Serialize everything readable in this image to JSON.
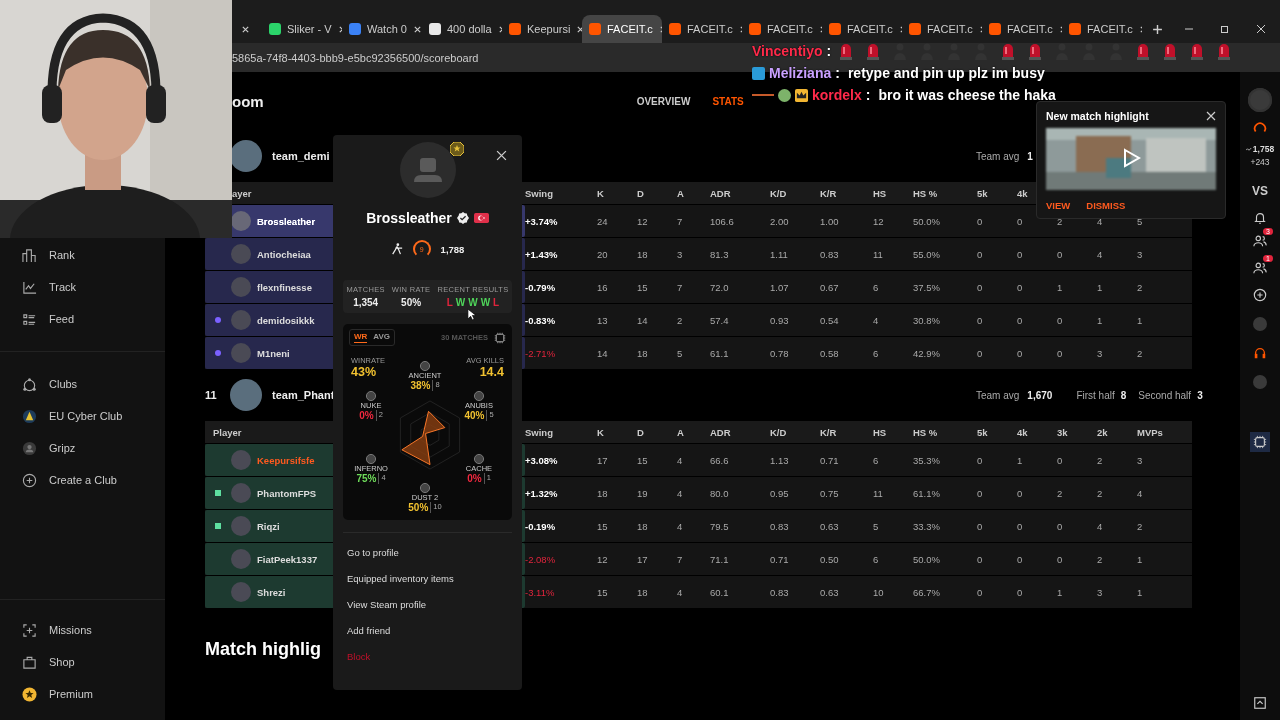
{
  "browser": {
    "tabs": [
      {
        "selected": false
      },
      {
        "title": "Sliker - V",
        "color": "#2bd46a",
        "selected": false
      },
      {
        "title": "Watch 0",
        "color": "#3b82f6",
        "selected": false
      },
      {
        "title": "400 dolla",
        "color": "#e8e8e8",
        "selected": false
      },
      {
        "title": "Keepursi",
        "color": "#ff5500",
        "selected": false
      },
      {
        "title": "FACEIT.c",
        "color": "#ff5500",
        "selected": true
      },
      {
        "title": "FACEIT.c",
        "color": "#ff5500",
        "selected": false
      },
      {
        "title": "FACEIT.c",
        "color": "#ff5500",
        "selected": false
      },
      {
        "title": "FACEIT.c",
        "color": "#ff5500",
        "selected": false
      },
      {
        "title": "FACEIT.c",
        "color": "#ff5500",
        "selected": false
      },
      {
        "title": "FACEIT.c",
        "color": "#ff5500",
        "selected": false
      },
      {
        "title": "FACEIT.c",
        "color": "#ff5500",
        "selected": false
      }
    ],
    "url": "5865a-74f8-4403-bbb9-e5bc92356500/scoreboard"
  },
  "chat": [
    {
      "user": "Vincentiyo",
      "color": "#ff2a4a",
      "sep": ":",
      "emotes": [
        {
          "kind": "siren"
        },
        {
          "kind": "siren"
        },
        {
          "kind": "figure"
        },
        {
          "kind": "figure"
        },
        {
          "kind": "figure"
        },
        {
          "kind": "figure"
        },
        {
          "kind": "siren"
        },
        {
          "kind": "siren"
        },
        {
          "kind": "figure"
        },
        {
          "kind": "figure"
        },
        {
          "kind": "figure"
        },
        {
          "kind": "siren"
        },
        {
          "kind": "siren"
        },
        {
          "kind": "siren"
        },
        {
          "kind": "siren"
        }
      ]
    },
    {
      "user": "Meliziana",
      "color": "#c9a0ff",
      "sep": ":",
      "text": "retype and pin up plz im busy"
    },
    {
      "user": "kordelx",
      "color": "#ff2a4a",
      "sep": ":",
      "text": "bro it was cheese the haka"
    }
  ],
  "sidebar": {
    "groups": [
      [
        {
          "label": "Rank",
          "kind": "rank"
        },
        {
          "label": "Track",
          "kind": "track"
        },
        {
          "label": "Feed",
          "kind": "feed"
        }
      ],
      [
        {
          "label": "Clubs",
          "kind": "clubs"
        },
        {
          "label": "EU Cyber Club",
          "kind": "club"
        },
        {
          "label": "Gripz",
          "kind": "avatar"
        },
        {
          "label": "Create a Club",
          "kind": "add"
        }
      ],
      [
        {
          "label": "Missions",
          "kind": "missions"
        },
        {
          "label": "Shop",
          "kind": "shop"
        },
        {
          "label": "Premium",
          "kind": "premium"
        }
      ]
    ]
  },
  "page": {
    "title": "oom",
    "tabs": [
      {
        "label": "OVERVIEW",
        "selected": false
      },
      {
        "label": "STATS",
        "selected": true
      }
    ],
    "teams": [
      {
        "name": "team_demi",
        "color": "#27284d",
        "avg_label": "Team avg",
        "avg_value": "1",
        "columns": [
          "ayer",
          "Swing",
          "K",
          "D",
          "A",
          "ADR",
          "K/D",
          "K/R",
          "HS",
          "HS %",
          "5k",
          "4k"
        ],
        "players": [
          {
            "name": "Brossleather",
            "selected": true,
            "highlighted": false,
            "swing_bad": false,
            "stats": [
              "+3.74%",
              "24",
              "12",
              "7",
              "106.6",
              "2.00",
              "1.00",
              "12",
              "50.0%",
              "0",
              "0",
              "2",
              "4",
              "5"
            ]
          },
          {
            "name": "Antiocheiaa",
            "selected": false,
            "highlighted": false,
            "swing_bad": false,
            "stats": [
              "+1.43%",
              "20",
              "18",
              "3",
              "81.3",
              "1.11",
              "0.83",
              "11",
              "55.0%",
              "0",
              "0",
              "0",
              "4",
              "3"
            ]
          },
          {
            "name": "flexnfinesse",
            "selected": false,
            "highlighted": false,
            "swing_bad": false,
            "stats": [
              "-0.79%",
              "16",
              "15",
              "7",
              "72.0",
              "1.07",
              "0.67",
              "6",
              "37.5%",
              "0",
              "0",
              "1",
              "1",
              "2"
            ]
          },
          {
            "name": "demidosikkk",
            "selected": false,
            "highlighted": false,
            "swing_bad": false,
            "marker": {
              "kind": "dot",
              "color": "#7b61ff"
            },
            "stats": [
              "-0.83%",
              "13",
              "14",
              "2",
              "57.4",
              "0.93",
              "0.54",
              "4",
              "30.8%",
              "0",
              "0",
              "0",
              "1",
              "1"
            ]
          },
          {
            "name": "M1neni",
            "selected": false,
            "highlighted": false,
            "swing_bad": true,
            "marker": {
              "kind": "dot",
              "color": "#7b61ff"
            },
            "stats": [
              "-2.71%",
              "14",
              "18",
              "5",
              "61.1",
              "0.78",
              "0.58",
              "6",
              "42.9%",
              "0",
              "0",
              "0",
              "3",
              "2"
            ]
          }
        ]
      },
      {
        "rank": "11",
        "name": "team_Phant",
        "color": "#1d3a30",
        "avg_label": "Team avg",
        "avg_value": "1,670",
        "halves": [
          {
            "label": "First half",
            "value": "8"
          },
          {
            "label": "Second half",
            "value": "3"
          }
        ],
        "columns": [
          "Player",
          "Swing",
          "K",
          "D",
          "A",
          "ADR",
          "K/D",
          "K/R",
          "HS",
          "HS %",
          "5k",
          "4k",
          "3k",
          "2k",
          "MVPs"
        ],
        "players": [
          {
            "name": "Keepursifsfe",
            "selected": false,
            "highlighted": true,
            "swing_bad": false,
            "stats": [
              "+3.08%",
              "17",
              "15",
              "4",
              "66.6",
              "1.13",
              "0.71",
              "6",
              "35.3%",
              "0",
              "1",
              "0",
              "2",
              "3"
            ]
          },
          {
            "name": "PhantomFPS",
            "selected": false,
            "highlighted": false,
            "swing_bad": false,
            "marker": {
              "kind": "square",
              "color": "#5ee0a0"
            },
            "stats": [
              "+1.32%",
              "18",
              "19",
              "4",
              "80.0",
              "0.95",
              "0.75",
              "11",
              "61.1%",
              "0",
              "0",
              "2",
              "2",
              "4"
            ]
          },
          {
            "name": "Riqzi",
            "selected": false,
            "highlighted": false,
            "swing_bad": false,
            "marker": {
              "kind": "square",
              "color": "#5ee0a0"
            },
            "stats": [
              "-0.19%",
              "15",
              "18",
              "4",
              "79.5",
              "0.83",
              "0.63",
              "5",
              "33.3%",
              "0",
              "0",
              "0",
              "4",
              "2"
            ]
          },
          {
            "name": "FiatPeek1337",
            "selected": false,
            "highlighted": false,
            "swing_bad": true,
            "stats": [
              "-2.08%",
              "12",
              "17",
              "7",
              "71.1",
              "0.71",
              "0.50",
              "6",
              "50.0%",
              "0",
              "0",
              "0",
              "2",
              "1"
            ]
          },
          {
            "name": "Shrezi",
            "selected": false,
            "highlighted": false,
            "swing_bad": true,
            "stats": [
              "-3.11%",
              "15",
              "18",
              "4",
              "60.1",
              "0.83",
              "0.63",
              "10",
              "66.7%",
              "0",
              "0",
              "1",
              "3",
              "1"
            ]
          }
        ]
      }
    ],
    "section_heading": "Match highlig"
  },
  "player_card": {
    "name": "Brossleather",
    "verified": true,
    "level": "9",
    "elo": "1,788",
    "stats": [
      {
        "label": "MATCHES",
        "value": "1,354"
      },
      {
        "label": "WIN RATE",
        "value": "50%"
      }
    ],
    "recent_label": "RECENT RESULTS",
    "recent": [
      {
        "result": "L",
        "win": false
      },
      {
        "result": "W",
        "win": true
      },
      {
        "result": "W",
        "win": true
      },
      {
        "result": "W",
        "win": true
      },
      {
        "result": "L",
        "win": false
      }
    ],
    "radar": {
      "tabs": [
        {
          "label": "WR",
          "selected": true
        },
        {
          "label": "AVG",
          "selected": false
        }
      ],
      "matches": "30 MATCHES",
      "winrate_label": "WINRATE",
      "winrate": "43%",
      "kills_label": "AVG KILLS",
      "kills": "14.4",
      "maps": [
        {
          "name": "ANCIENT",
          "rate": "38%",
          "games": "8",
          "color": "#f2c230"
        },
        {
          "name": "NUKE",
          "rate": "0%",
          "games": "2",
          "color": "#f0283f"
        },
        {
          "name": "ANUBIS",
          "rate": "40%",
          "games": "5",
          "color": "#f2c230"
        },
        {
          "name": "INFERNO",
          "rate": "75%",
          "games": "4",
          "color": "#6fdc5a"
        },
        {
          "name": "CACHE",
          "rate": "0%",
          "games": "1",
          "color": "#f0283f"
        },
        {
          "name": "DUST 2",
          "rate": "50%",
          "games": "10",
          "color": "#f2c230"
        }
      ]
    },
    "menu": [
      {
        "label": "Go to profile",
        "kind": "normal"
      },
      {
        "label": "Equipped inventory items",
        "kind": "normal"
      },
      {
        "label": "View Steam profile",
        "kind": "normal"
      },
      {
        "label": "Add friend",
        "kind": "normal"
      },
      {
        "label": "Block",
        "kind": "danger"
      }
    ]
  },
  "notification": {
    "title": "New match highlight",
    "actions": [
      "VIEW",
      "DISMISS"
    ]
  },
  "rail": {
    "elo": "1,758",
    "change": "+243",
    "vs": "VS",
    "badges": [
      "3",
      "1"
    ]
  }
}
